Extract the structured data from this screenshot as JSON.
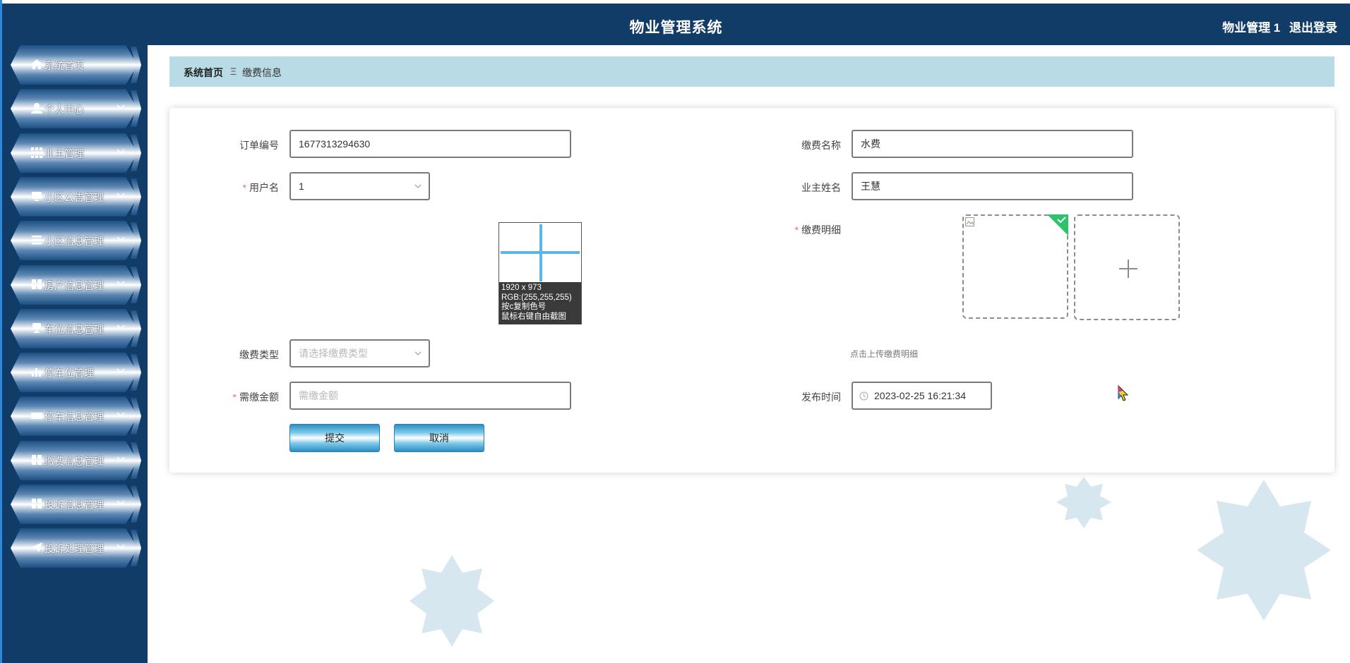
{
  "header": {
    "title": "物业管理系统",
    "username": "物业管理 1",
    "logout": "退出登录"
  },
  "sidebar": {
    "items": [
      {
        "label": "系统首页",
        "icon": "home-icon",
        "expandable": false
      },
      {
        "label": "个人中心",
        "icon": "user-icon",
        "expandable": true
      },
      {
        "label": "业主管理",
        "icon": "grid-icon",
        "expandable": true
      },
      {
        "label": "小区公告管理",
        "icon": "monitor-icon",
        "expandable": true
      },
      {
        "label": "小区信息管理",
        "icon": "list-icon",
        "expandable": true
      },
      {
        "label": "房产信息管理",
        "icon": "blocks-icon",
        "expandable": true
      },
      {
        "label": "车位信息管理",
        "icon": "trophy-icon",
        "expandable": true
      },
      {
        "label": "停车位管理",
        "icon": "bar-chart-icon",
        "expandable": true
      },
      {
        "label": "停车信息管理",
        "icon": "ticket-icon",
        "expandable": true
      },
      {
        "label": "缴费信息管理",
        "icon": "blocks-icon",
        "expandable": true
      },
      {
        "label": "投诉信息管理",
        "icon": "blocks-icon",
        "expandable": true
      },
      {
        "label": "投诉处理管理",
        "icon": "send-icon",
        "expandable": true
      }
    ]
  },
  "breadcrumb": {
    "home": "系统首页",
    "separator": "Ξ",
    "current": "缴费信息"
  },
  "form": {
    "order_no": {
      "label": "订单编号",
      "value": "1677313294630"
    },
    "fee_name": {
      "label": "缴费名称",
      "value": "水费"
    },
    "username": {
      "label": "用户名",
      "value": "1"
    },
    "owner_name": {
      "label": "业主姓名",
      "value": "王慧"
    },
    "fee_detail": {
      "label": "缴费明细",
      "tip": "点击上传缴费明细"
    },
    "fee_type": {
      "label": "缴费类型",
      "placeholder": "请选择缴费类型"
    },
    "amount": {
      "label": "需缴金额",
      "placeholder": "需缴金额"
    },
    "publish_time": {
      "label": "发布时间",
      "value": "2023-02-25 16:21:34"
    },
    "submit": "提交",
    "cancel": "取消"
  },
  "picker_overlay": {
    "size": "1920 x 973",
    "rgb": "RGB:(255,255,255)",
    "copy_hint": "按c复制色号",
    "crop_hint": "鼠标右键自由截图"
  },
  "colors": {
    "header_bg": "#123c68",
    "breadcrumb_bg": "#b8dbe5",
    "required": "#f56c6c",
    "upload_badge": "#2bc46a"
  }
}
